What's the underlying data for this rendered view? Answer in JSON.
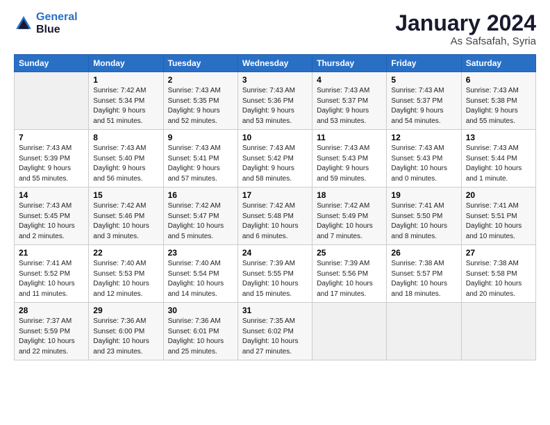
{
  "header": {
    "logo_line1": "General",
    "logo_line2": "Blue",
    "title": "January 2024",
    "subtitle": "As Safsafah, Syria"
  },
  "days_of_week": [
    "Sunday",
    "Monday",
    "Tuesday",
    "Wednesday",
    "Thursday",
    "Friday",
    "Saturday"
  ],
  "weeks": [
    [
      {
        "num": "",
        "info": ""
      },
      {
        "num": "1",
        "info": "Sunrise: 7:42 AM\nSunset: 5:34 PM\nDaylight: 9 hours\nand 51 minutes."
      },
      {
        "num": "2",
        "info": "Sunrise: 7:43 AM\nSunset: 5:35 PM\nDaylight: 9 hours\nand 52 minutes."
      },
      {
        "num": "3",
        "info": "Sunrise: 7:43 AM\nSunset: 5:36 PM\nDaylight: 9 hours\nand 53 minutes."
      },
      {
        "num": "4",
        "info": "Sunrise: 7:43 AM\nSunset: 5:37 PM\nDaylight: 9 hours\nand 53 minutes."
      },
      {
        "num": "5",
        "info": "Sunrise: 7:43 AM\nSunset: 5:37 PM\nDaylight: 9 hours\nand 54 minutes."
      },
      {
        "num": "6",
        "info": "Sunrise: 7:43 AM\nSunset: 5:38 PM\nDaylight: 9 hours\nand 55 minutes."
      }
    ],
    [
      {
        "num": "7",
        "info": "Sunrise: 7:43 AM\nSunset: 5:39 PM\nDaylight: 9 hours\nand 55 minutes."
      },
      {
        "num": "8",
        "info": "Sunrise: 7:43 AM\nSunset: 5:40 PM\nDaylight: 9 hours\nand 56 minutes."
      },
      {
        "num": "9",
        "info": "Sunrise: 7:43 AM\nSunset: 5:41 PM\nDaylight: 9 hours\nand 57 minutes."
      },
      {
        "num": "10",
        "info": "Sunrise: 7:43 AM\nSunset: 5:42 PM\nDaylight: 9 hours\nand 58 minutes."
      },
      {
        "num": "11",
        "info": "Sunrise: 7:43 AM\nSunset: 5:43 PM\nDaylight: 9 hours\nand 59 minutes."
      },
      {
        "num": "12",
        "info": "Sunrise: 7:43 AM\nSunset: 5:43 PM\nDaylight: 10 hours\nand 0 minutes."
      },
      {
        "num": "13",
        "info": "Sunrise: 7:43 AM\nSunset: 5:44 PM\nDaylight: 10 hours\nand 1 minute."
      }
    ],
    [
      {
        "num": "14",
        "info": "Sunrise: 7:43 AM\nSunset: 5:45 PM\nDaylight: 10 hours\nand 2 minutes."
      },
      {
        "num": "15",
        "info": "Sunrise: 7:42 AM\nSunset: 5:46 PM\nDaylight: 10 hours\nand 3 minutes."
      },
      {
        "num": "16",
        "info": "Sunrise: 7:42 AM\nSunset: 5:47 PM\nDaylight: 10 hours\nand 5 minutes."
      },
      {
        "num": "17",
        "info": "Sunrise: 7:42 AM\nSunset: 5:48 PM\nDaylight: 10 hours\nand 6 minutes."
      },
      {
        "num": "18",
        "info": "Sunrise: 7:42 AM\nSunset: 5:49 PM\nDaylight: 10 hours\nand 7 minutes."
      },
      {
        "num": "19",
        "info": "Sunrise: 7:41 AM\nSunset: 5:50 PM\nDaylight: 10 hours\nand 8 minutes."
      },
      {
        "num": "20",
        "info": "Sunrise: 7:41 AM\nSunset: 5:51 PM\nDaylight: 10 hours\nand 10 minutes."
      }
    ],
    [
      {
        "num": "21",
        "info": "Sunrise: 7:41 AM\nSunset: 5:52 PM\nDaylight: 10 hours\nand 11 minutes."
      },
      {
        "num": "22",
        "info": "Sunrise: 7:40 AM\nSunset: 5:53 PM\nDaylight: 10 hours\nand 12 minutes."
      },
      {
        "num": "23",
        "info": "Sunrise: 7:40 AM\nSunset: 5:54 PM\nDaylight: 10 hours\nand 14 minutes."
      },
      {
        "num": "24",
        "info": "Sunrise: 7:39 AM\nSunset: 5:55 PM\nDaylight: 10 hours\nand 15 minutes."
      },
      {
        "num": "25",
        "info": "Sunrise: 7:39 AM\nSunset: 5:56 PM\nDaylight: 10 hours\nand 17 minutes."
      },
      {
        "num": "26",
        "info": "Sunrise: 7:38 AM\nSunset: 5:57 PM\nDaylight: 10 hours\nand 18 minutes."
      },
      {
        "num": "27",
        "info": "Sunrise: 7:38 AM\nSunset: 5:58 PM\nDaylight: 10 hours\nand 20 minutes."
      }
    ],
    [
      {
        "num": "28",
        "info": "Sunrise: 7:37 AM\nSunset: 5:59 PM\nDaylight: 10 hours\nand 22 minutes."
      },
      {
        "num": "29",
        "info": "Sunrise: 7:36 AM\nSunset: 6:00 PM\nDaylight: 10 hours\nand 23 minutes."
      },
      {
        "num": "30",
        "info": "Sunrise: 7:36 AM\nSunset: 6:01 PM\nDaylight: 10 hours\nand 25 minutes."
      },
      {
        "num": "31",
        "info": "Sunrise: 7:35 AM\nSunset: 6:02 PM\nDaylight: 10 hours\nand 27 minutes."
      },
      {
        "num": "",
        "info": ""
      },
      {
        "num": "",
        "info": ""
      },
      {
        "num": "",
        "info": ""
      }
    ]
  ]
}
